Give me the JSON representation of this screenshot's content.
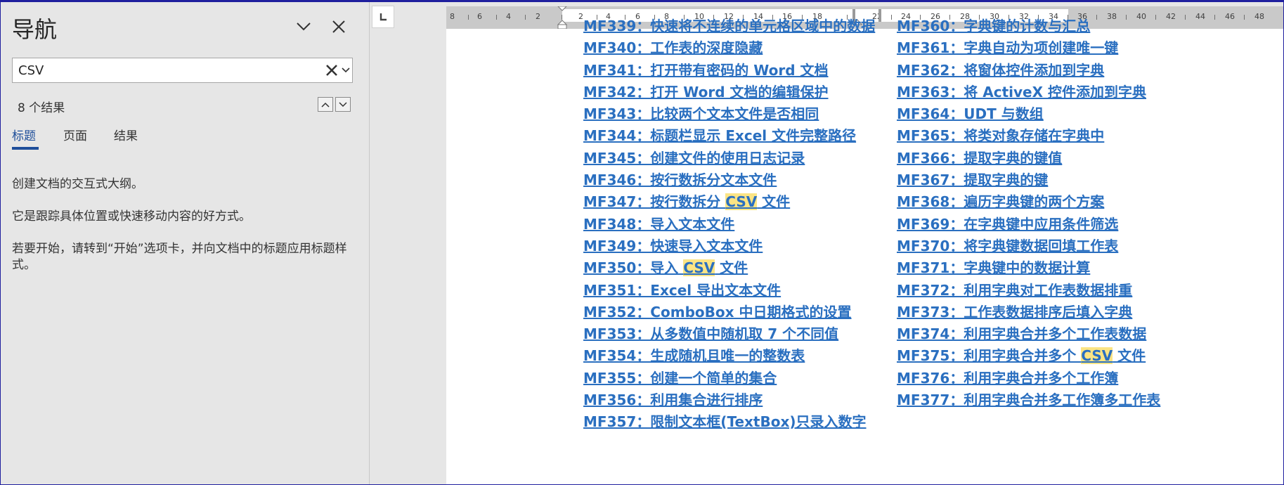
{
  "nav": {
    "title": "导航",
    "search": {
      "value": "CSV",
      "placeholder": ""
    },
    "result_count": "8 个结果",
    "tabs": [
      {
        "label": "标题"
      },
      {
        "label": "页面"
      },
      {
        "label": "结果"
      }
    ],
    "info": [
      "创建文档的交互式大纲。",
      "它是跟踪具体位置或快速移动内容的好方式。",
      "若要开始，请转到“开始”选项卡，并向文档中的标题应用标题样式。"
    ]
  },
  "ruler": {
    "labels": [
      "8",
      "6",
      "4",
      "2",
      "2",
      "4",
      "6",
      "8",
      "10",
      "12",
      "14",
      "16",
      "18",
      "22",
      "24",
      "26",
      "28",
      "30",
      "32",
      "34",
      "36",
      "38",
      "40",
      "42",
      "44",
      "46",
      "48"
    ]
  },
  "document": {
    "left_partial": "MF339：快速将不连续的单元格区域中的数据",
    "right_partial": "MF360：字典键的计数与汇总",
    "left_column": [
      [
        "MF340：工作表的深度隐藏"
      ],
      [
        "MF341：打开带有密码的 Word 文档"
      ],
      [
        "MF342：打开 Word 文档的编辑保护"
      ],
      [
        "MF343：比较两个文本文件是否相同"
      ],
      [
        "MF344：标题栏显示 Excel 文件完整路径"
      ],
      [
        "MF345：创建文件的使用日志记录"
      ],
      [
        "MF346：按行数拆分文本文件"
      ],
      [
        "MF347：按行数拆分 ",
        "CSV",
        " 文件"
      ],
      [
        "MF348：导入文本文件"
      ],
      [
        "MF349：快速导入文本文件"
      ],
      [
        "MF350：导入 ",
        "CSV",
        " 文件"
      ],
      [
        "MF351：Excel 导出文本文件"
      ],
      [
        "MF352：ComboBox 中日期格式的设置"
      ],
      [
        "MF353：从多数值中随机取 7 个不同值"
      ],
      [
        "MF354：生成随机且唯一的整数表"
      ],
      [
        "MF355：创建一个简单的集合"
      ],
      [
        "MF356：利用集合进行排序"
      ],
      [
        "MF357：限制文本框(TextBox)只录入数字"
      ]
    ],
    "right_column": [
      [
        "MF361：字典自动为项创建唯一键"
      ],
      [
        "MF362：将窗体控件添加到字典"
      ],
      [
        "MF363：将 ActiveX 控件添加到字典"
      ],
      [
        "MF364：UDT 与数组"
      ],
      [
        "MF365：将类对象存储在字典中"
      ],
      [
        "MF366：提取字典的键值"
      ],
      [
        "MF367：提取字典的键"
      ],
      [
        "MF368：遍历字典键的两个方案"
      ],
      [
        "MF369：在字典键中应用条件筛选"
      ],
      [
        "MF370：将字典键数据回填工作表"
      ],
      [
        "MF371：字典键中的数据计算"
      ],
      [
        "MF372：利用字典对工作表数据排重"
      ],
      [
        "MF373：工作表数据排序后填入字典"
      ],
      [
        "MF374：利用字典合并多个工作表数据"
      ],
      [
        "MF375：利用字典合并多个 ",
        "CSV",
        " 文件"
      ],
      [
        "MF376：利用字典合并多个工作簿"
      ],
      [
        "MF377：利用字典合并多工作簿多工作表"
      ]
    ]
  }
}
